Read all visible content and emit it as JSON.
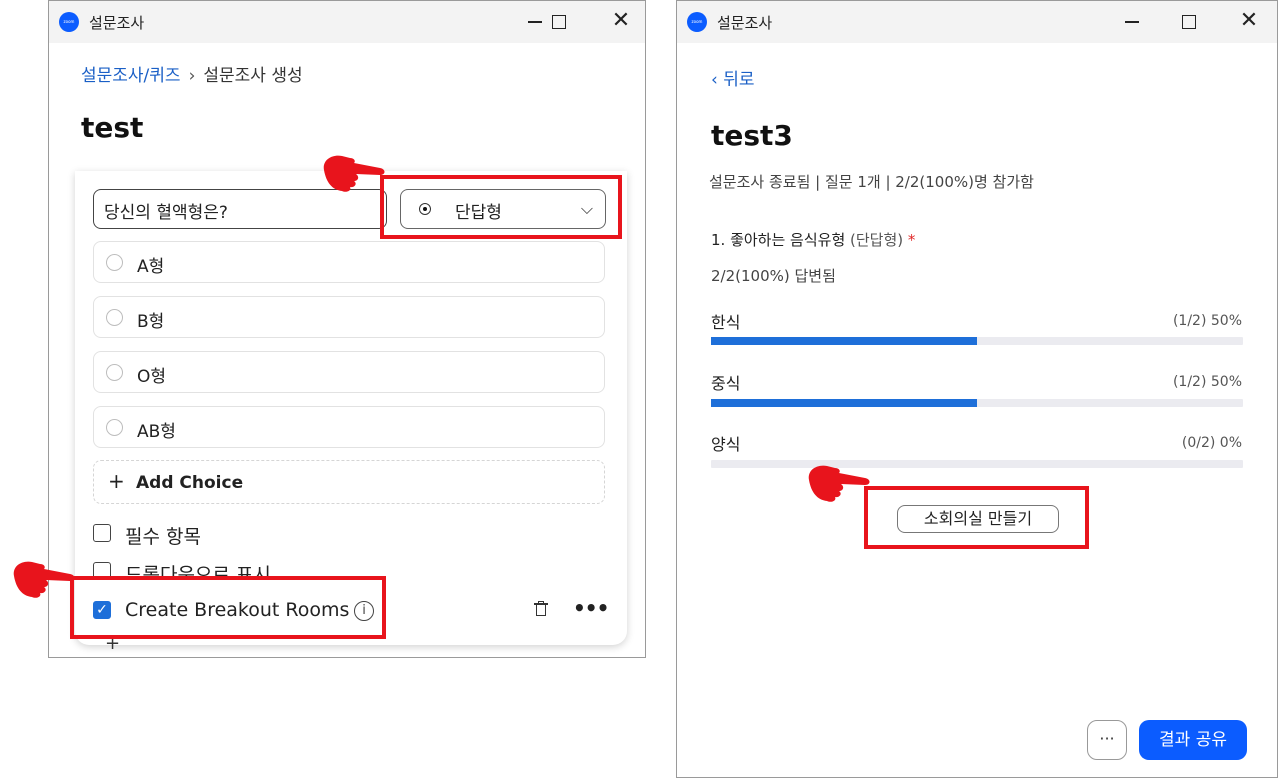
{
  "left_window": {
    "title": "설문조사",
    "icon_text": "zoom",
    "breadcrumb": {
      "link": "설문조사/퀴즈",
      "separator": "›",
      "current": "설문조사 생성"
    },
    "page_title": "test",
    "question": {
      "text": "당신의 혈액형은?",
      "type_label": "단답형",
      "choices": [
        "A형",
        "B형",
        "O형",
        "AB형"
      ],
      "add_choice_label": "Add Choice"
    },
    "options": {
      "required_label": "필수 항목",
      "dropdown_label": "드롭다운으로 표시",
      "breakout_label": "Create Breakout Rooms",
      "breakout_checked": true
    }
  },
  "right_window": {
    "title": "설문조사",
    "icon_text": "zoom",
    "back_label": "뒤로",
    "poll_title": "test3",
    "status_line": "설문조사 종료됨 | 질문 1개 | 2/2(100%)명 참가함",
    "question_label": "1. 좋아하는 음식유형",
    "question_type": "(단답형)",
    "required_mark": "*",
    "answered_line": "2/2(100%) 답변됨",
    "results": [
      {
        "label": "한식",
        "count": "(1/2) 50%",
        "fraction": 0.5
      },
      {
        "label": "중식",
        "count": "(1/2) 50%",
        "fraction": 0.5
      },
      {
        "label": "양식",
        "count": "(0/2) 0%",
        "fraction": 0.0
      }
    ],
    "breakout_button": "소회의실 만들기",
    "more_button": "···",
    "share_button": "결과 공유"
  },
  "colors": {
    "accent": "#0b5cff",
    "bar": "#1e6fd9",
    "highlight": "#e8141c"
  }
}
